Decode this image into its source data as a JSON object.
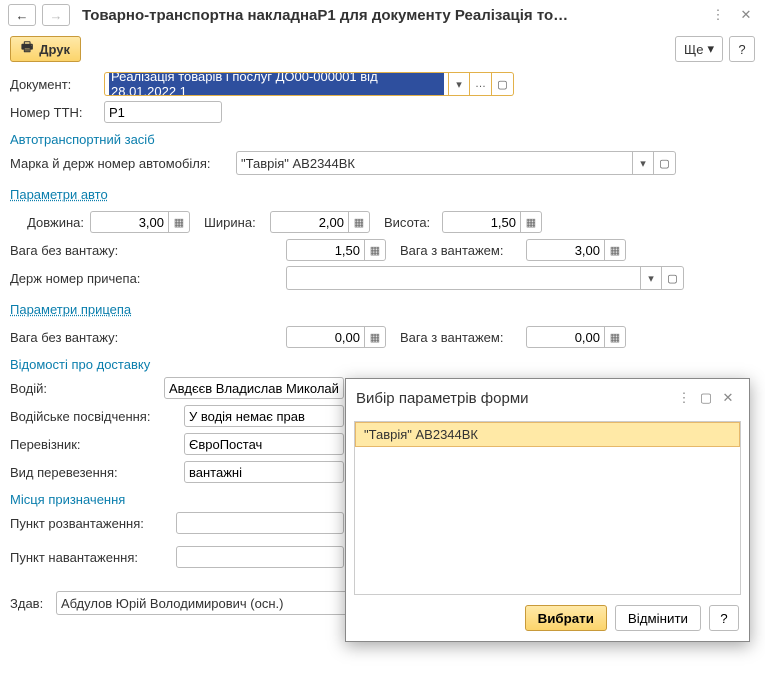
{
  "header": {
    "title": "Товарно-транспортна накладнаР1 для документу Реалізація то…"
  },
  "toolbar": {
    "print_label": "Друк",
    "more_label": "Ще",
    "help_label": "?"
  },
  "doc": {
    "label": "Документ:",
    "value": "Реалізація товарів і послуг ДО00-000001 від 28.01.2022 1"
  },
  "ttn": {
    "label": "Номер ТТН:",
    "value": "Р1"
  },
  "sections": {
    "auto": "Автотранспортний засіб",
    "auto_params": "Параметри авто",
    "trailer_params": "Параметри прицепа",
    "delivery": "Відомості про доставку",
    "destination": "Місця призначення"
  },
  "vehicle": {
    "brand_label": "Марка й держ номер автомобіля:",
    "brand_value": "\"Таврія\" АВ2344ВК",
    "length_label": "Довжина:",
    "length_value": "3,00",
    "width_label": "Ширина:",
    "width_value": "2,00",
    "height_label": "Висота:",
    "height_value": "1,50",
    "weight_empty_label": "Вага без вантажу:",
    "weight_empty_value": "1,50",
    "weight_loaded_label": "Вага з вантажем:",
    "weight_loaded_value": "3,00",
    "trailer_plate_label": "Держ номер причепа:",
    "trailer_plate_value": "",
    "trailer_weight_empty_value": "0,00",
    "trailer_weight_loaded_value": "0,00"
  },
  "delivery": {
    "driver_label": "Водій:",
    "driver_value": "Авдєєв Владислав Миколай",
    "license_label": "Водійське посвідчення:",
    "license_value": "У водія немає прав",
    "carrier_label": "Перевізник:",
    "carrier_value": "ЄвроПостач",
    "transport_type_label": "Вид перевезення:",
    "transport_type_value": "вантажні"
  },
  "destination": {
    "unload_label": "Пункт розвантаження:",
    "unload_value": "",
    "load_label": "Пункт навантаження:",
    "load_value": ""
  },
  "issuer": {
    "label": "Здав:",
    "value": "Абдулов Юрій Володимирович (осн.)"
  },
  "popup": {
    "title": "Вибір параметрів форми",
    "item": "\"Таврія\" АВ2344ВК",
    "select": "Вибрати",
    "cancel": "Відмінити",
    "help": "?"
  }
}
